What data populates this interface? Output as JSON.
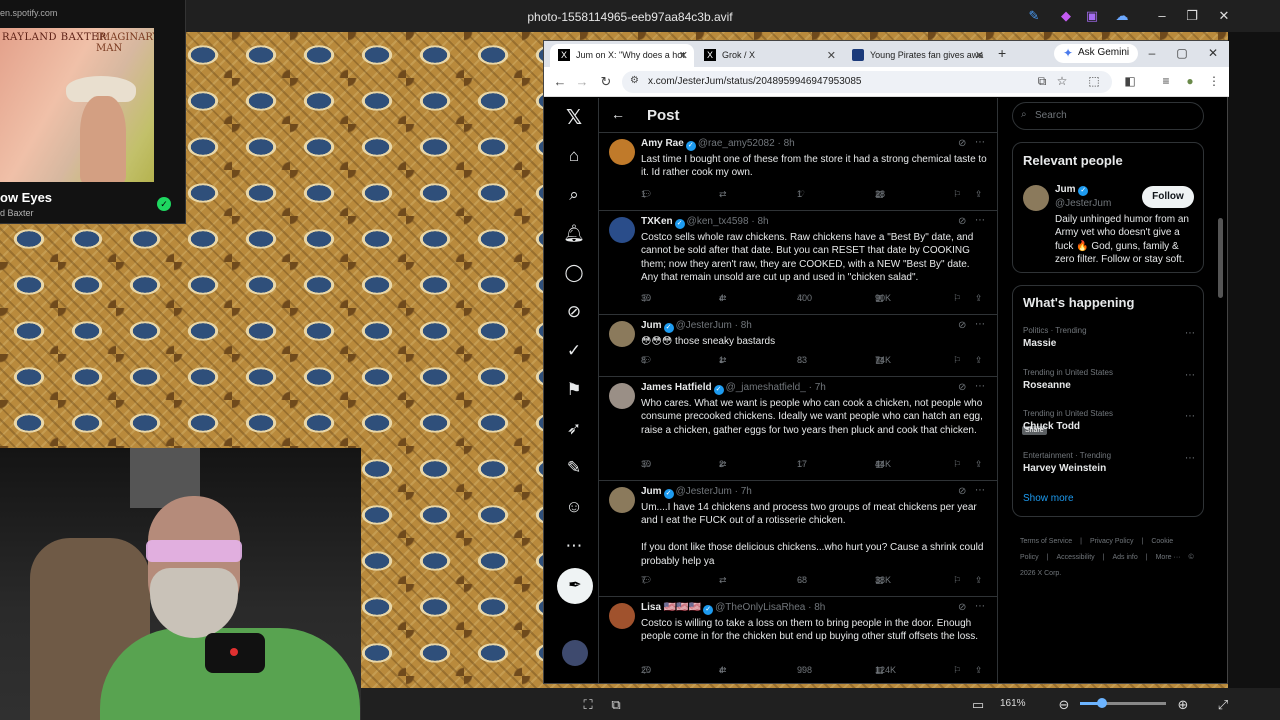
{
  "viewer": {
    "title": "photo-1558114965-eeb97aa84c3b.avif",
    "zoom": "161%",
    "zoom_fraction": 0.25
  },
  "spotify": {
    "url": "en.spotify.com",
    "album_artist": "RAYLAND BAXTER",
    "album_title": "IMAGINARY MAN",
    "song": "ow Eyes",
    "artist": "d Baxter"
  },
  "browser": {
    "tabs": [
      {
        "label": "Jum on X: \"Why does a hot",
        "icon": "x-logo-icon"
      },
      {
        "label": "Grok / X",
        "icon": "grok-icon"
      },
      {
        "label": "Young Pirates fan gives awa",
        "icon": "mlb-icon"
      }
    ],
    "ask_gemini": "Ask Gemini",
    "url": "x.com/JesterJum/status/2048959946947953085"
  },
  "x": {
    "header": "Post",
    "tweets": [
      {
        "name": "Amy Rae",
        "handle": "@rae_amy52082",
        "time": "8h",
        "text": "Last time I bought one of these from the store it had a strong chemical taste to it. Id rather cook my own.",
        "replies": "1",
        "reposts": "",
        "likes": "1",
        "views": "28",
        "avatar": "#c07a2a"
      },
      {
        "name": "TXKen",
        "handle": "@ken_tx4598",
        "time": "8h",
        "text": "Costco sells whole raw chickens. Raw chickens have a \"Best By\" date, and cannot be sold after that date. But you can RESET that date by COOKING them; now they aren't raw, they are COOKED, with a NEW \"Best By\" date. Any that remain unsold are cut up and used in \"chicken salad\".",
        "replies": "30",
        "reposts": "4",
        "likes": "400",
        "views": "90K",
        "avatar": "#2a4d8a"
      },
      {
        "name": "Jum",
        "handle": "@JesterJum",
        "time": "8h",
        "text": "😳😳😳 those sneaky bastards",
        "replies": "8",
        "reposts": "1",
        "likes": "83",
        "views": "74K",
        "avatar": "#8b7a5c"
      },
      {
        "name": "James Hatfield",
        "handle": "@_jameshatfield_",
        "time": "7h",
        "text": "Who cares. What we want is people who can cook a chicken, not people who consume precooked chickens. Ideally we want people who can hatch an egg, raise a chicken, gather eggs for two years then pluck and cook that chicken.",
        "replies": "30",
        "reposts": "2",
        "likes": "17",
        "views": "44K",
        "avatar": "#9a8f86"
      },
      {
        "name": "Jum",
        "handle": "@JesterJum",
        "time": "7h",
        "text": "Um....I have 14 chickens and process two groups of meat chickens per year and I eat the FUCK out of a rotisserie chicken.\n\nIf you dont like those delicious chickens...who hurt you? Cause a shrink could probably help ya",
        "replies": "7",
        "reposts": "",
        "likes": "68",
        "views": "38K",
        "avatar": "#8b7a5c"
      },
      {
        "name": "Lisa 🇺🇸🇺🇸🇺🇸",
        "handle": "@TheOnlyLisaRhea",
        "time": "8h",
        "text": "Costco is willing to take a loss on them to bring people in the door. Enough people come in for the chicken but end up buying other stuff offsets the loss.",
        "replies": "20",
        "reposts": "4",
        "likes": "998",
        "views": "124K",
        "avatar": "#a0522d"
      }
    ],
    "share_tooltip": "Share",
    "search_placeholder": "Search",
    "relevant": {
      "title": "Relevant people",
      "name": "Jum",
      "handle": "@JesterJum",
      "follow": "Follow",
      "bio": "Daily unhinged humor from an Army vet who doesn't give a fuck 🔥 God, guns, family & zero filter. Follow or stay soft."
    },
    "happening": {
      "title": "What's happening",
      "trends": [
        {
          "context": "Politics · Trending",
          "name": "Massie"
        },
        {
          "context": "Trending in United States",
          "name": "Roseanne"
        },
        {
          "context": "Trending in United States",
          "name": "Chuck Todd"
        },
        {
          "context": "Entertainment · Trending",
          "name": "Harvey Weinstein"
        }
      ],
      "show_more": "Show more"
    },
    "footer": [
      "Terms of Service",
      "|",
      "Privacy Policy",
      "|",
      "Cookie Policy",
      "|",
      "Accessibility",
      "|",
      "Ads info",
      "|",
      "More ···",
      "© 2026 X Corp."
    ]
  },
  "colors": {
    "x_blue": "#1d9bf0",
    "spotify_green": "#1ed760",
    "x_bg": "#000000"
  }
}
